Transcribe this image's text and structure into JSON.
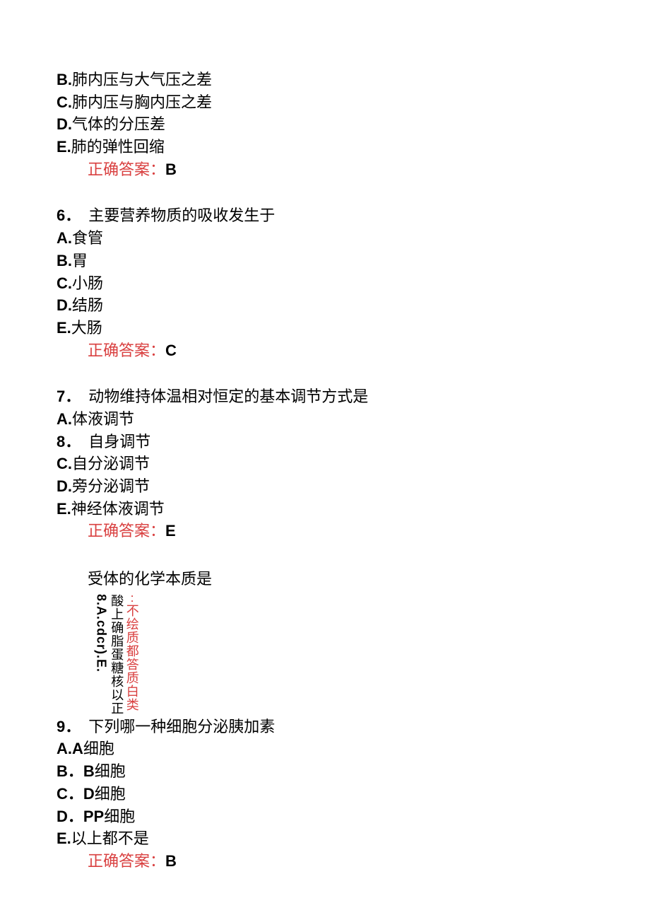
{
  "q5": {
    "optB": {
      "letter": "B.",
      "text": "肺内压与大气压之差"
    },
    "optC": {
      "letter": "C.",
      "text": "肺内压与胸内压之差"
    },
    "optD": {
      "letter": "D.",
      "text": "气体的分压差"
    },
    "optE": {
      "letter": "E.",
      "text": "肺的弹性回缩"
    },
    "ans_label": "正确答案：",
    "ans_val": "B"
  },
  "q6": {
    "num": "6．",
    "stem": "主要营养物质的吸收发生于",
    "optA": {
      "letter": "A.",
      "text": "食管"
    },
    "optB": {
      "letter": "B.",
      "text": "胃"
    },
    "optC": {
      "letter": "C.",
      "text": "小肠"
    },
    "optD": {
      "letter": "D.",
      "text": "结肠"
    },
    "optE": {
      "letter": "E.",
      "text": "大肠"
    },
    "ans_label": "正确答案：",
    "ans_val": "C"
  },
  "q7": {
    "num": "7．",
    "stem": "动物维持体温相对恒定的基本调节方式是",
    "optA": {
      "letter": "A.",
      "text": "体液调节"
    },
    "line8": {
      "num": "8．",
      "text": "自身调节"
    },
    "optC": {
      "letter": "C.",
      "text": "自分泌调节"
    },
    "optD": {
      "letter": "D.",
      "text": "旁分泌调节"
    },
    "optE": {
      "letter": "E.",
      "text": "神经体液调节"
    },
    "ans_label": "正确答案：",
    "ans_val": "E"
  },
  "q8v": {
    "stem": "受体的化学本质是",
    "col1_bold": "8.A.cdcr).E.",
    "col2": "酸上确脂蛋糖核以正",
    "col3": "··不绘质都答质白类"
  },
  "q9": {
    "num": "9．",
    "stem": "下列哪一种细胞分泌胰加素",
    "optA": {
      "letter": "A.A",
      "text": "细胞"
    },
    "optB": {
      "letter": "B．B",
      "text": "细胞"
    },
    "optC": {
      "letter": "C．D",
      "text": "细胞"
    },
    "optD": {
      "letter": "D．PP",
      "text": "细胞"
    },
    "optE": {
      "letter": "E.",
      "text": "以上都不是"
    },
    "ans_label": "正确答案：",
    "ans_val": "B"
  }
}
